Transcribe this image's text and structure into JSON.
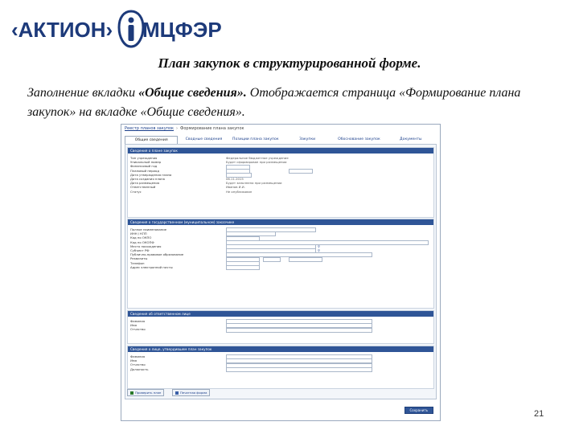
{
  "logo": {
    "left_text": "‹АКТИОН›",
    "right_text": "МЦФЭР"
  },
  "slide": {
    "title": "План закупок в структурированной форме.",
    "desc_prefix": "Заполнение вкладки ",
    "desc_bold": "«Общие сведения».",
    "desc_rest": " Отображается страница «Формирование плана закупок» на вкладке «Общие сведения».",
    "page_number": "21"
  },
  "screenshot": {
    "breadcrumb": {
      "link": "Реестр планов закупок",
      "current": "Формирование плана закупок"
    },
    "tabs": [
      {
        "label": "Общие сведения",
        "active": true
      },
      {
        "label": "Сводные сведения",
        "active": false
      },
      {
        "label": "Позиции плана закупок",
        "active": false
      },
      {
        "label": "Закупки",
        "active": false
      },
      {
        "label": "Обоснование закупок",
        "active": false
      },
      {
        "label": "Документы",
        "active": false
      }
    ],
    "sections": [
      {
        "title": "Сведения о плане закупок",
        "rows": [
          {
            "label": "Тип учреждения",
            "value": "Федеральное бюджетное учреждение"
          },
          {
            "label": "Уникальный номер",
            "value": "Будет сформирован при размещении"
          },
          {
            "label": "Финансовый год",
            "value": "2016"
          },
          {
            "label": "Плановый период",
            "value": "2017 – 2018"
          },
          {
            "label": "Дата утверждения плана",
            "value": ""
          },
          {
            "label": "Дата создания плана",
            "value": "06.11.2015"
          },
          {
            "label": "Дата размещения",
            "value": "Будет заполнена при размещении"
          },
          {
            "label": "Ответственный",
            "value": "Иванов И.И."
          },
          {
            "label": "Статус",
            "value": "Не опубликован"
          }
        ]
      },
      {
        "title": "Сведения о государственном (муниципальном) заказчике",
        "rows": [
          {
            "label": "Полное наименование",
            "value": "Федеральное казенное учреждение"
          },
          {
            "label": "ИНН / КПП",
            "value": ""
          },
          {
            "label": "Код по ОКПО",
            "value": ""
          },
          {
            "label": "Код по ОКОПФ",
            "value": ""
          },
          {
            "label": "Место нахождения",
            "value": ""
          },
          {
            "label": "Субъект РФ",
            "value": ""
          },
          {
            "label": "Публично-правовое образование",
            "value": ""
          },
          {
            "label": "Реквизиты",
            "value": ""
          },
          {
            "label": "Телефон",
            "value": ""
          },
          {
            "label": "Адрес электронной почты",
            "value": ""
          }
        ]
      },
      {
        "title": "Сведения об ответственном лице",
        "rows": [
          {
            "label": "Фамилия",
            "value": ""
          },
          {
            "label": "Имя",
            "value": ""
          },
          {
            "label": "Отчество",
            "value": ""
          }
        ]
      },
      {
        "title": "Сведения о лице, утвердившем план закупок",
        "rows": [
          {
            "label": "Фамилия",
            "value": ""
          },
          {
            "label": "Имя",
            "value": ""
          },
          {
            "label": "Отчество",
            "value": ""
          },
          {
            "label": "Должность",
            "value": ""
          }
        ]
      }
    ],
    "buttons": {
      "validate": "Проверить план",
      "print": "Печатная форма",
      "save": "Сохранить"
    }
  }
}
